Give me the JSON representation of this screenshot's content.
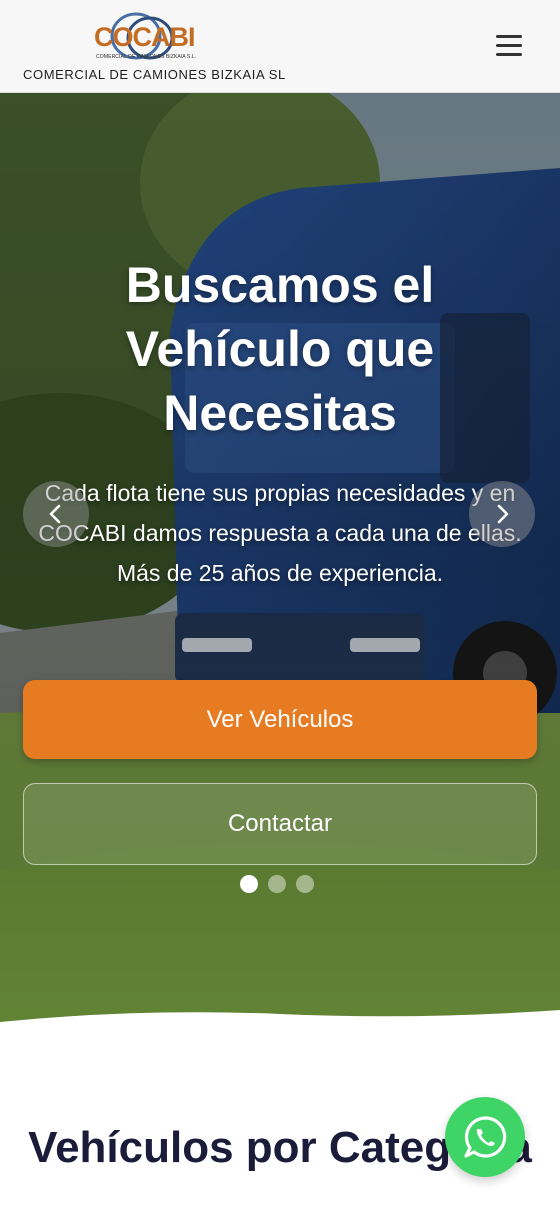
{
  "header": {
    "logo_text": "COCABI",
    "logo_subtext": "COMERCIAL DE CAMIONES BIZKAIA S.L.",
    "company_name": "COMERCIAL DE CAMIONES BIZKAIA SL",
    "menu_icon": "hamburger-menu-icon"
  },
  "hero": {
    "title": "Buscamos el Vehículo que Necesitas",
    "subtitle": "Cada flota tiene sus propias necesidades y en COCABI damos respuesta a cada una de ellas. Más de 25 años de experiencia.",
    "primary_button": "Ver Vehículos",
    "secondary_button": "Contactar",
    "prev_icon": "chevron-left-icon",
    "next_icon": "chevron-right-icon",
    "slides": 3,
    "active_slide": 1
  },
  "categories": {
    "title": "Vehículos por Categoría"
  },
  "floating": {
    "whatsapp_icon": "whatsapp-icon"
  },
  "colors": {
    "accent": "#e77b22",
    "whatsapp": "#3fd466",
    "heading": "#1b1b3a"
  }
}
